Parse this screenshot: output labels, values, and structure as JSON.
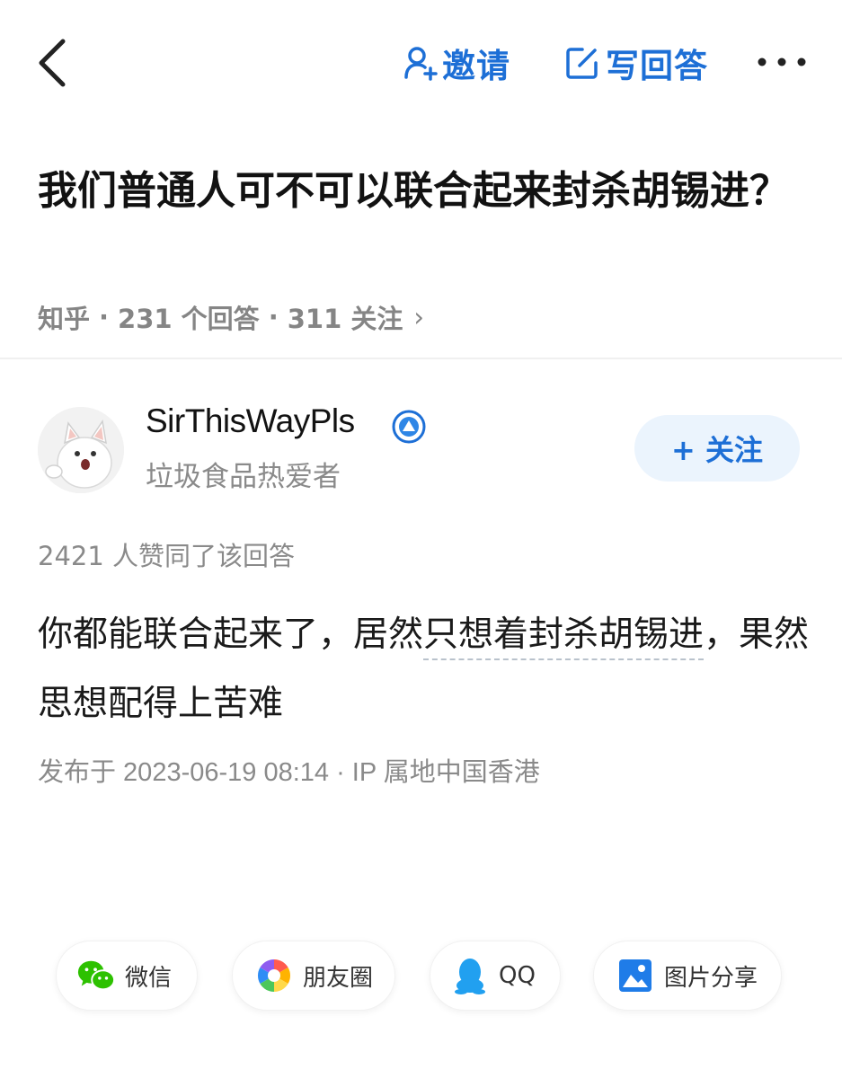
{
  "header": {
    "back_icon": "chevron-left-icon",
    "invite_label": "邀请",
    "invite_icon": "add-user-icon",
    "write_label": "写回答",
    "write_icon": "edit-icon",
    "more_icon": "more-horizontal-icon",
    "accent_color": "#1d6fd6"
  },
  "question": {
    "title": "我们普通人可不可以联合起来封杀胡锡进？",
    "source": "知乎",
    "answer_count": "231 个回答",
    "follower_count": "311 关注",
    "separator": "·",
    "arrow": "›"
  },
  "author": {
    "name": "SirThisWayPls",
    "bio": "垃圾食品热爱者",
    "follow_label": "+ 关注",
    "badge_icon": "verified-badge-icon"
  },
  "answer": {
    "likes_text": "2421 人赞同了该回答",
    "body_plain": "你都能联合起来了，居然",
    "body_highlight": "只想着封杀胡锡进",
    "body_rest": "，果然思想配得上苦难",
    "publish_text": "发布于 2023-06-19 08:14 · IP 属地中国香港"
  },
  "share": {
    "items": [
      {
        "label": "微信",
        "icon": "wechat-icon"
      },
      {
        "label": "朋友圈",
        "icon": "moments-icon"
      },
      {
        "label": "QQ",
        "icon": "qq-icon"
      },
      {
        "label": "图片分享",
        "icon": "image-share-icon"
      }
    ]
  }
}
